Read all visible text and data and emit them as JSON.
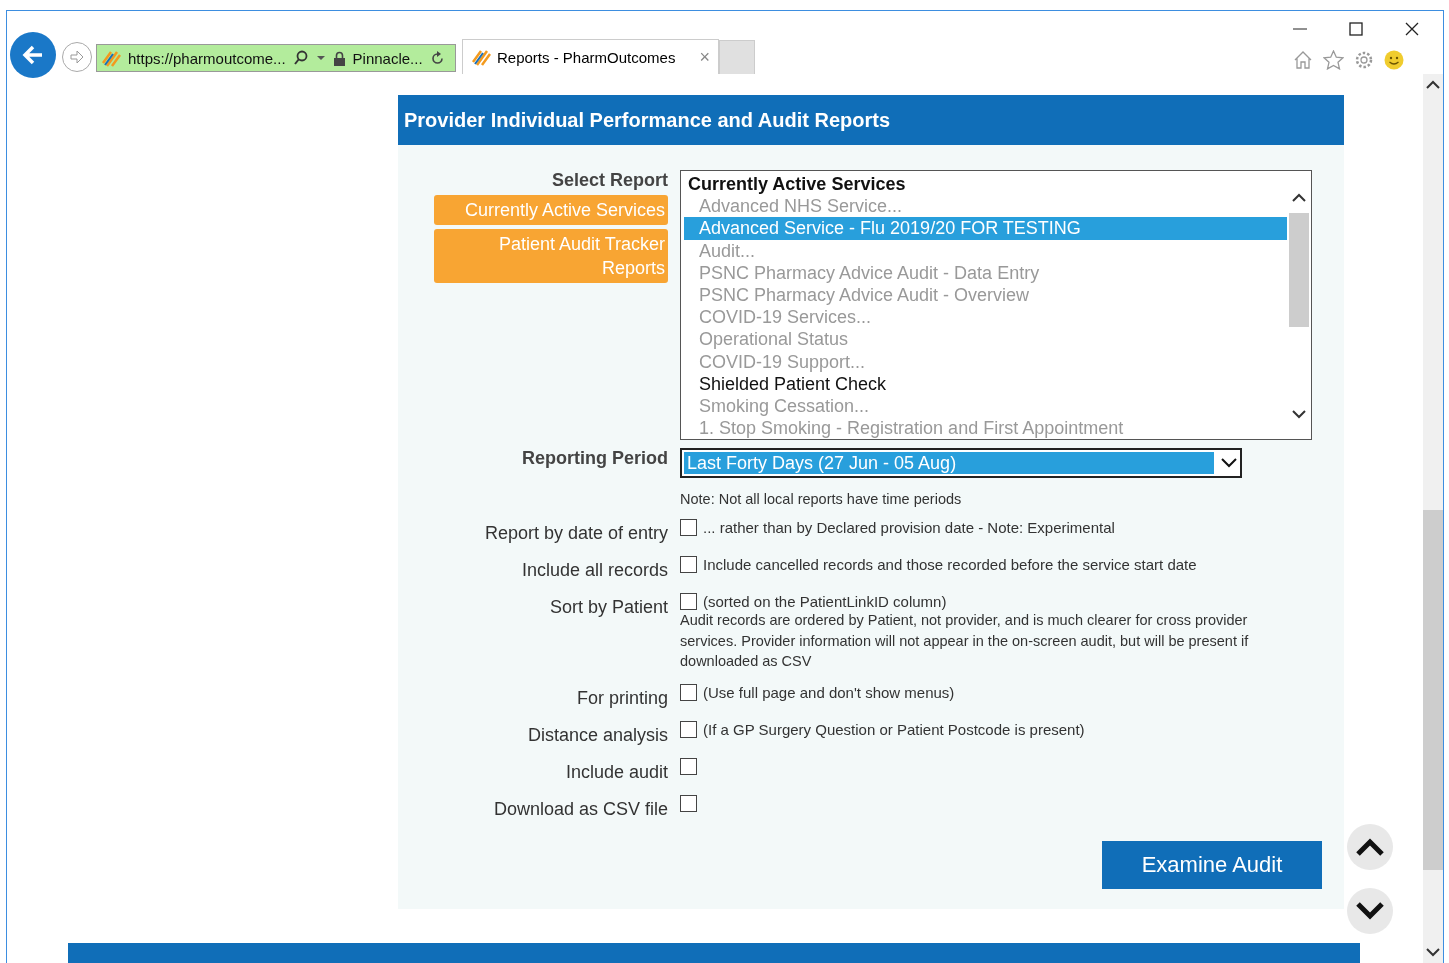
{
  "browser": {
    "address": "https://pharmoutcome...",
    "site_identity": "Pinnacle...",
    "tabs": [
      {
        "title": "Reports - PharmOutcomes",
        "selected": true,
        "close": "×"
      }
    ]
  },
  "panel": {
    "title": "Provider Individual Performance and Audit Reports"
  },
  "select_report": {
    "label": "Select Report",
    "shortcuts": [
      "Currently Active Services",
      "Patient Audit Tracker Reports"
    ],
    "options": [
      {
        "kind": "header",
        "text": "Currently Active Services",
        "selected": false,
        "disabled": false
      },
      {
        "kind": "option",
        "text": "Advanced NHS Service...",
        "selected": false,
        "disabled": true
      },
      {
        "kind": "option",
        "text": "Advanced Service - Flu 2019/20 FOR TESTING",
        "selected": true,
        "disabled": false
      },
      {
        "kind": "option",
        "text": "Audit...",
        "selected": false,
        "disabled": true
      },
      {
        "kind": "option",
        "text": "PSNC Pharmacy Advice Audit - Data Entry",
        "selected": false,
        "disabled": true
      },
      {
        "kind": "option",
        "text": "PSNC Pharmacy Advice Audit - Overview",
        "selected": false,
        "disabled": true
      },
      {
        "kind": "option",
        "text": "COVID-19 Services...",
        "selected": false,
        "disabled": true
      },
      {
        "kind": "option",
        "text": "Operational Status",
        "selected": false,
        "disabled": true
      },
      {
        "kind": "option",
        "text": "COVID-19 Support...",
        "selected": false,
        "disabled": true
      },
      {
        "kind": "option",
        "text": "Shielded Patient Check",
        "selected": false,
        "disabled": false
      },
      {
        "kind": "option",
        "text": "Smoking Cessation...",
        "selected": false,
        "disabled": true
      },
      {
        "kind": "option",
        "text": "1. Stop Smoking - Registration and First Appointment",
        "selected": false,
        "disabled": true
      }
    ]
  },
  "reporting_period": {
    "label": "Reporting Period",
    "value": "Last Forty Days (27 Jun - 05 Aug)",
    "note": "Note: Not all local reports have time periods"
  },
  "options": [
    {
      "label": "Report by date of entry",
      "checked": false,
      "note": "... rather than by Declared provision date - Note: Experimental"
    },
    {
      "label": "Include all records",
      "checked": false,
      "note": "Include cancelled records and those recorded before the service start date"
    },
    {
      "label": "Sort by Patient",
      "checked": false,
      "note": "(sorted on the PatientLinkID column)",
      "description": "Audit records are ordered by Patient, not provider, and is much clearer for cross provider services. Provider information will not appear in the on-screen audit, but will be present if downloaded as CSV"
    },
    {
      "label": "For printing",
      "checked": false,
      "note": "(Use full page and don't show menus)"
    },
    {
      "label": "Distance analysis",
      "checked": false,
      "note": "(If a GP Surgery Question or Patient Postcode is present)"
    },
    {
      "label": "Include audit",
      "checked": false
    },
    {
      "label": "Download as CSV file",
      "checked": false
    }
  ],
  "submit": "Examine Audit"
}
